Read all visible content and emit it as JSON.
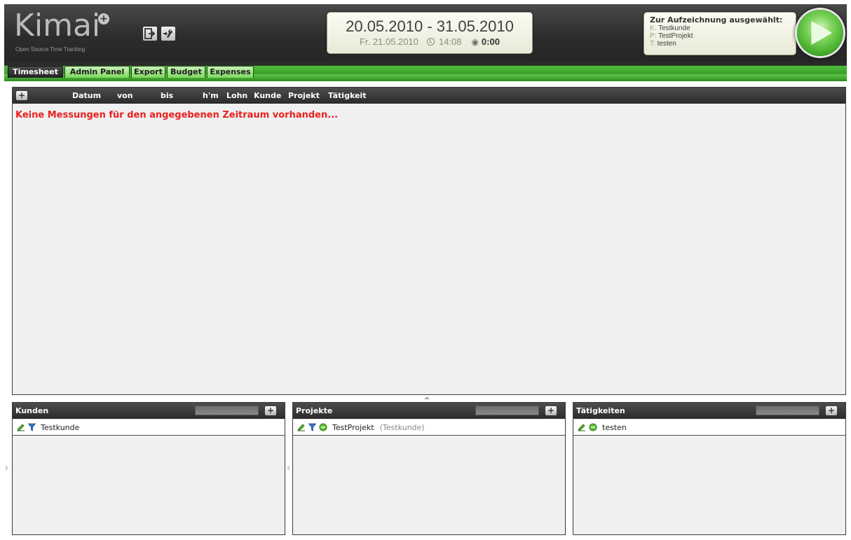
{
  "header": {
    "logo_text": "Kimai",
    "logo_subtitle": "Open Source Time Tracking",
    "logout_icon": "logout-icon",
    "settings_icon": "settings-wrench-icon",
    "date_range": "20.05.2010 - 31.05.2010",
    "current_date": "Fr. 21.05.2010",
    "current_time": "14:08",
    "duration": "0:00",
    "selection": {
      "title": "Zur Aufzeichnung ausgewählt:",
      "customer_key": "K:",
      "customer": "Testkunde",
      "project_key": "P:",
      "project": "TestProjekt",
      "activity_key": "T:",
      "activity": "testen"
    },
    "start_button_icon": "play-icon"
  },
  "tabs": [
    {
      "label": "Timesheet",
      "active": true
    },
    {
      "label": "Admin Panel",
      "active": false
    },
    {
      "label": "Export",
      "active": false
    },
    {
      "label": "Budget",
      "active": false
    },
    {
      "label": "Expenses",
      "active": false
    }
  ],
  "timesheet": {
    "add_label": "+",
    "columns": [
      "Datum",
      "von",
      "bis",
      "h'm",
      "Lohn",
      "Kunde",
      "Projekt",
      "Tätigkeit"
    ],
    "empty_message": "Keine Messungen für den angegebenen Zeitraum vorhanden..."
  },
  "lists": {
    "customers": {
      "title": "Kunden",
      "add_label": "+",
      "items": [
        {
          "name": "Testkunde"
        }
      ]
    },
    "projects": {
      "title": "Projekte",
      "add_label": "+",
      "items": [
        {
          "name": "TestProjekt",
          "customer": "(Testkunde)"
        }
      ]
    },
    "activities": {
      "title": "Tätigkeiten",
      "add_label": "+",
      "items": [
        {
          "name": "testen"
        }
      ]
    }
  },
  "colors": {
    "accent_green": "#3aa129",
    "error_red": "#e8211e",
    "header_dark": "#2d2d2d"
  }
}
